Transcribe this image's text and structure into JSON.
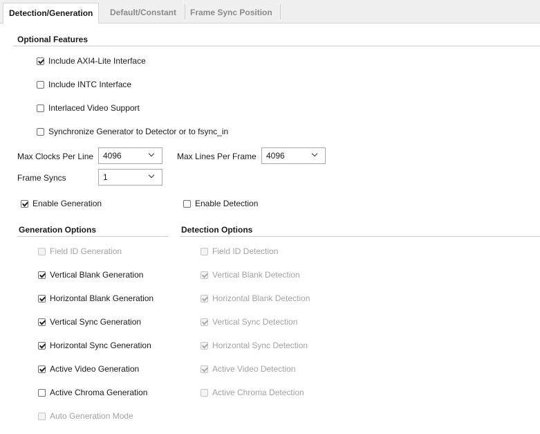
{
  "tabs": [
    {
      "label": "Detection/Generation",
      "active": true
    },
    {
      "label": "Default/Constant",
      "active": false
    },
    {
      "label": "Frame Sync Position",
      "active": false
    }
  ],
  "optional_features": {
    "title": "Optional Features",
    "items": [
      {
        "label": "Include AXI4-Lite Interface",
        "checked": true
      },
      {
        "label": "Include INTC Interface",
        "checked": false
      },
      {
        "label": "Interlaced Video Support",
        "checked": false
      },
      {
        "label": "Synchronize Generator to Detector or to fsync_in",
        "checked": false
      }
    ]
  },
  "fields": {
    "max_clocks": {
      "label": "Max Clocks Per Line",
      "value": "4096"
    },
    "max_lines": {
      "label": "Max Lines Per Frame",
      "value": "4096"
    },
    "frame_syncs": {
      "label": "Frame Syncs",
      "value": "1"
    }
  },
  "enable": {
    "generation": {
      "label": "Enable Generation",
      "checked": true
    },
    "detection": {
      "label": "Enable Detection",
      "checked": false
    }
  },
  "generation_options": {
    "title": "Generation Options",
    "items": [
      {
        "label": "Field ID Generation",
        "checked": false,
        "disabled": true
      },
      {
        "label": "Vertical Blank Generation",
        "checked": true,
        "disabled": false
      },
      {
        "label": "Horizontal Blank Generation",
        "checked": true,
        "disabled": false
      },
      {
        "label": "Vertical Sync Generation",
        "checked": true,
        "disabled": false
      },
      {
        "label": "Horizontal Sync Generation",
        "checked": true,
        "disabled": false
      },
      {
        "label": "Active Video Generation",
        "checked": true,
        "disabled": false
      },
      {
        "label": "Active Chroma Generation",
        "checked": false,
        "disabled": false
      },
      {
        "label": "Auto Generation Mode",
        "checked": false,
        "disabled": true
      }
    ]
  },
  "detection_options": {
    "title": "Detection Options",
    "items": [
      {
        "label": "Field ID Detection",
        "checked": false,
        "disabled": true
      },
      {
        "label": "Vertical Blank Detection",
        "checked": true,
        "disabled": true
      },
      {
        "label": "Horizontal Blank Detection",
        "checked": true,
        "disabled": true
      },
      {
        "label": "Vertical Sync Detection",
        "checked": true,
        "disabled": true
      },
      {
        "label": "Horizontal Sync Detection",
        "checked": true,
        "disabled": true
      },
      {
        "label": "Active Video Detection",
        "checked": true,
        "disabled": true
      },
      {
        "label": "Active Chroma Detection",
        "checked": false,
        "disabled": true
      }
    ]
  }
}
